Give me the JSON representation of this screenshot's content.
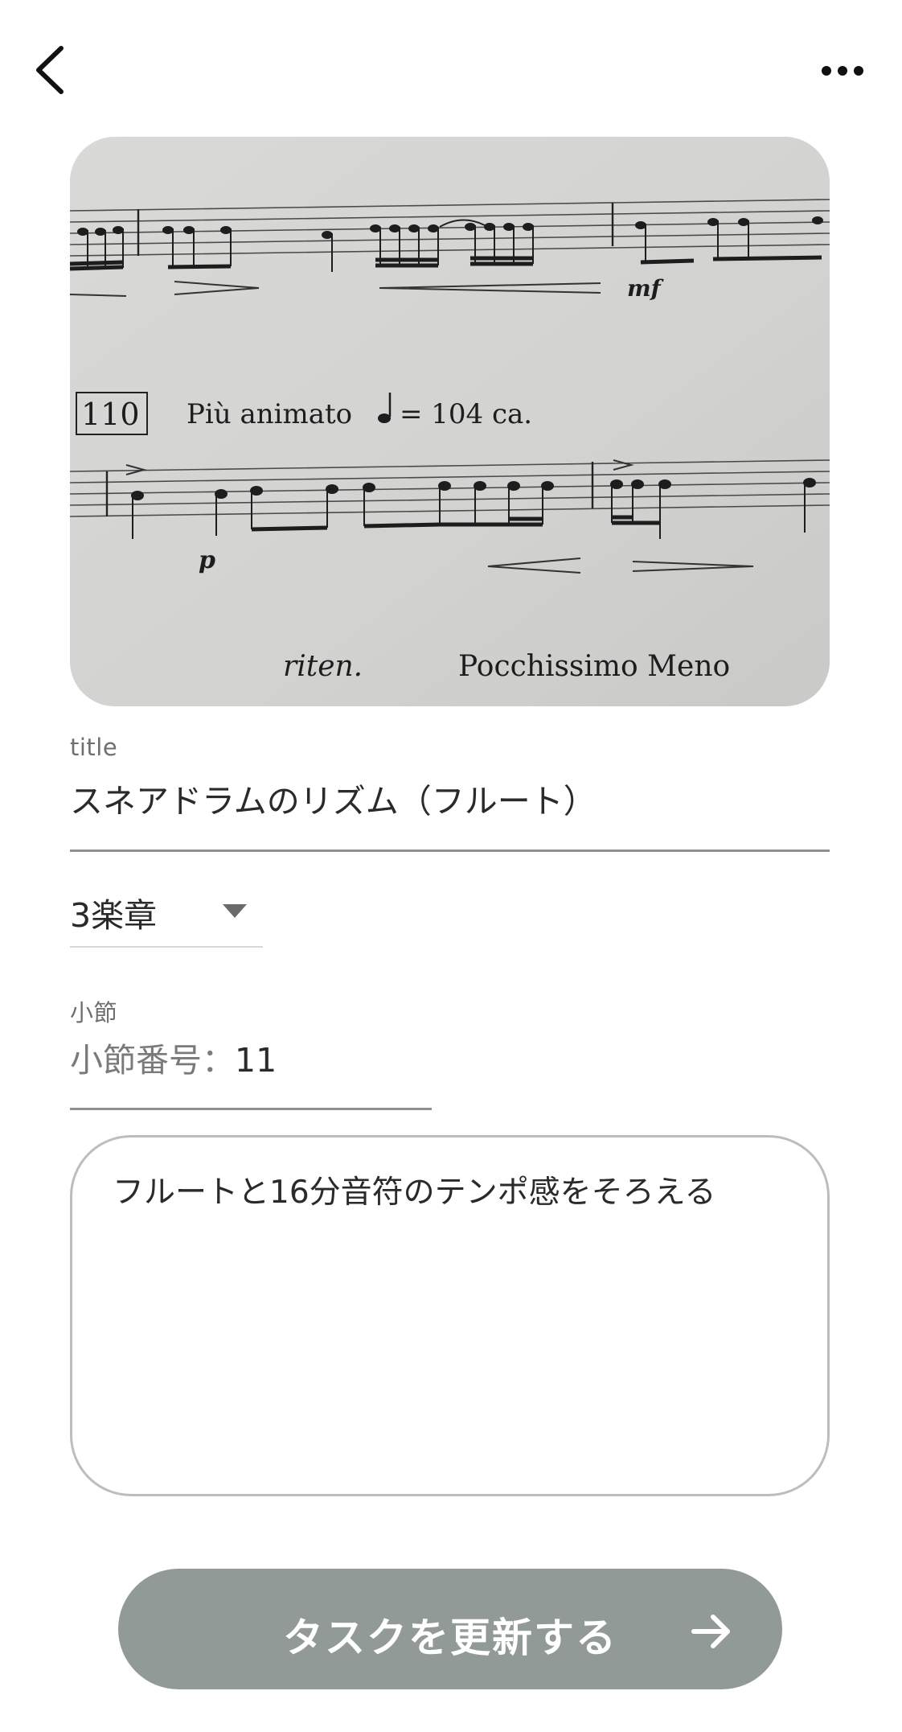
{
  "header": {
    "back_icon": "chevron-left-icon",
    "more_icon": "more-horizontal-icon"
  },
  "photo": {
    "tempo_marking": "Più animato",
    "tempo_value": "= 104 ca.",
    "rehearsal_number": "110",
    "dynamic_mf": "mf",
    "dynamic_p": "p",
    "riten": "riten.",
    "meno": "Pocchissimo Meno"
  },
  "form": {
    "title_label": "title",
    "title_value": "スネアドラムのリズム（フルート）",
    "movement_value": "3楽章",
    "measure_label": "小節",
    "measure_prefix": "小節番号：",
    "measure_value": "11",
    "memo_value": "フルートと16分音符のテンポ感をそろえる"
  },
  "actions": {
    "submit_label": "タスクを更新する",
    "submit_icon": "arrow-right-icon"
  }
}
